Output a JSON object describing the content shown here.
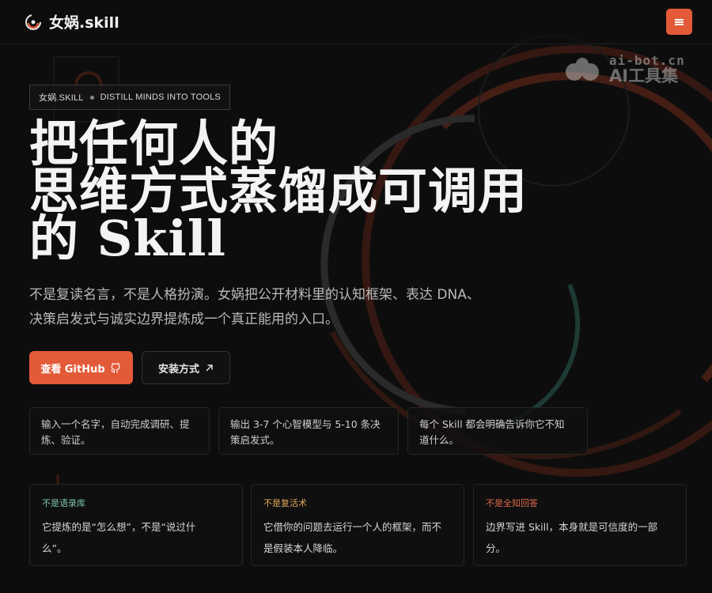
{
  "header": {
    "brand_name": "女娲.skill",
    "logo_icon": "swirl-logo-icon",
    "menu_icon": "hamburger-icon"
  },
  "watermark": {
    "top": "ai-bot.cn",
    "bottom": "AI工具集"
  },
  "hero": {
    "tag_left": "女娲.SKILL",
    "tag_right": "DISTILL MINDS INTO TOOLS",
    "headline_lines": [
      "把任何人的",
      "思维方式蒸馏成可调用",
      "的 Skill"
    ],
    "subtitle_lines": [
      "不是复读名言，不是人格扮演。女娲把公开材料里的认知框架、表达 DNA、",
      "决策启发式与诚实边界提炼成一个真正能用的入口。"
    ],
    "primary_button": "查看 GitHub",
    "secondary_button": "安装方式"
  },
  "features": [
    {
      "lines": [
        "输入一个名字，自动完成调研、提",
        "炼、验证。"
      ]
    },
    {
      "lines": [
        "输出 3-7 个心智模型与 5-10 条决",
        "策启发式。"
      ]
    },
    {
      "lines": [
        "每个 Skill 都会明确告诉你它不知",
        "道什么。"
      ]
    }
  ],
  "cards": [
    {
      "tag": "不是语录库",
      "tag_color": "#7fc7a8",
      "lines": [
        "它提炼的是“怎么想”，不是“说过什",
        "么”。"
      ]
    },
    {
      "tag": "不是复活术",
      "tag_color": "#e0a95a",
      "lines": [
        "它借你的问题去运行一个人的框架，而不",
        "是假装本人降临。"
      ]
    },
    {
      "tag": "不是全知回答",
      "tag_color": "#e06a4a",
      "lines": [
        "边界写进 Skill，本身就是可信度的一部",
        "分。"
      ]
    }
  ],
  "colors": {
    "accent": "#e35a38",
    "background": "#0d0d0d"
  }
}
